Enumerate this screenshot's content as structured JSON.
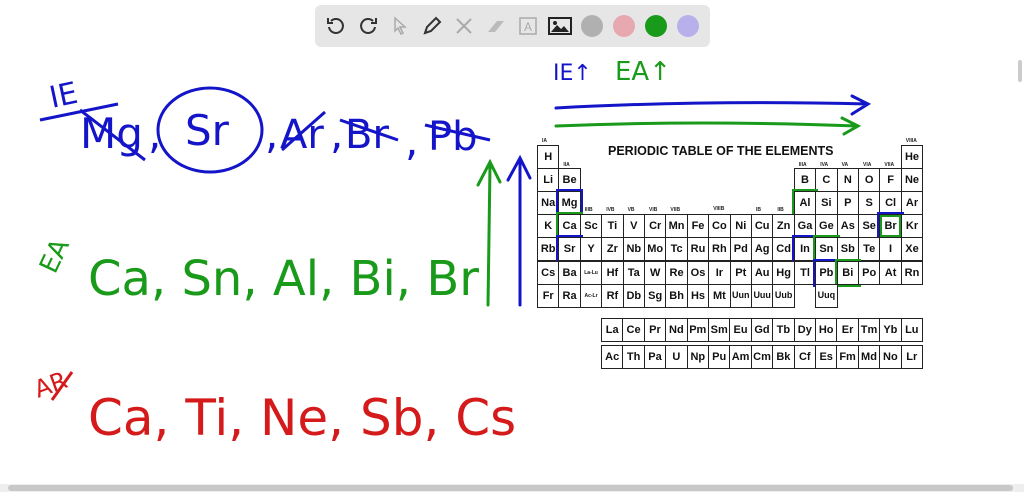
{
  "toolbar": {
    "tools": [
      "undo",
      "redo",
      "select",
      "pen",
      "tools",
      "eraser",
      "text",
      "image"
    ],
    "colors": [
      "#b0b0b0",
      "#e8a8b0",
      "#1a9a1a",
      "#b8b0ea"
    ],
    "selected_color": "#1a9a1a"
  },
  "notes": {
    "ie_label": "IE",
    "ie_items": [
      "Mg",
      ",",
      "Sr",
      ",",
      "Ar",
      ",",
      "Br",
      ",",
      "Pb"
    ],
    "ea_label": "EA",
    "ea_list": "Ca, Sn, Al, Bi, Br",
    "ar_label": "AR",
    "ar_list": "Ca, Ti, Ne, Sb, Cs",
    "trend_ie": "IE↑",
    "trend_ea": "EA↑"
  },
  "colors": {
    "blue": "#1414c8",
    "green": "#1a9a1a",
    "red": "#d41a1a"
  },
  "periodic_table": {
    "title": "PERIODIC TABLE OF THE ELEMENTS",
    "group_labels": [
      "IA",
      "IIA",
      "IIIB",
      "IVB",
      "VB",
      "VIB",
      "VIIB",
      "VIIIB",
      "IB",
      "IIB",
      "IIIA",
      "IVA",
      "VA",
      "VIA",
      "VIIA",
      "VIIIA"
    ],
    "rows": [
      [
        "H",
        "",
        "",
        "",
        "",
        "",
        "",
        "",
        "",
        "",
        "",
        "",
        "",
        "",
        "",
        "",
        "",
        "He"
      ],
      [
        "Li",
        "Be",
        "",
        "",
        "",
        "",
        "",
        "",
        "",
        "",
        "",
        "",
        "B",
        "C",
        "N",
        "O",
        "F",
        "Ne"
      ],
      [
        "Na",
        "Mg",
        "",
        "",
        "",
        "",
        "",
        "",
        "",
        "",
        "",
        "",
        "Al",
        "Si",
        "P",
        "S",
        "Cl",
        "Ar"
      ],
      [
        "K",
        "Ca",
        "Sc",
        "Ti",
        "V",
        "Cr",
        "Mn",
        "Fe",
        "Co",
        "Ni",
        "Cu",
        "Zn",
        "Ga",
        "Ge",
        "As",
        "Se",
        "Br",
        "Kr"
      ],
      [
        "Rb",
        "Sr",
        "Y",
        "Zr",
        "Nb",
        "Mo",
        "Tc",
        "Ru",
        "Rh",
        "Pd",
        "Ag",
        "Cd",
        "In",
        "Sn",
        "Sb",
        "Te",
        "I",
        "Xe"
      ],
      [
        "Cs",
        "Ba",
        "La-Lu",
        "Hf",
        "Ta",
        "W",
        "Re",
        "Os",
        "Ir",
        "Pt",
        "Au",
        "Hg",
        "Tl",
        "Pb",
        "Bi",
        "Po",
        "At",
        "Rn"
      ],
      [
        "Fr",
        "Ra",
        "Ac-Lr",
        "Rf",
        "Db",
        "Sg",
        "Bh",
        "Hs",
        "Mt",
        "Uun",
        "Uuu",
        "Uub",
        "",
        "Uuq",
        "",
        "",
        "",
        ""
      ]
    ],
    "lanthanides": [
      "La",
      "Ce",
      "Pr",
      "Nd",
      "Pm",
      "Sm",
      "Eu",
      "Gd",
      "Tb",
      "Dy",
      "Ho",
      "Er",
      "Tm",
      "Yb",
      "Lu"
    ],
    "actinides": [
      "Ac",
      "Th",
      "Pa",
      "U",
      "Np",
      "Pu",
      "Am",
      "Cm",
      "Bk",
      "Cf",
      "Es",
      "Fm",
      "Md",
      "No",
      "Lr"
    ],
    "highlighted_blue": [
      "Mg",
      "Sr",
      "In",
      "Pb",
      "Br"
    ],
    "highlighted_green": [
      "Ca",
      "Al",
      "Sn",
      "Bi",
      "Br"
    ]
  }
}
